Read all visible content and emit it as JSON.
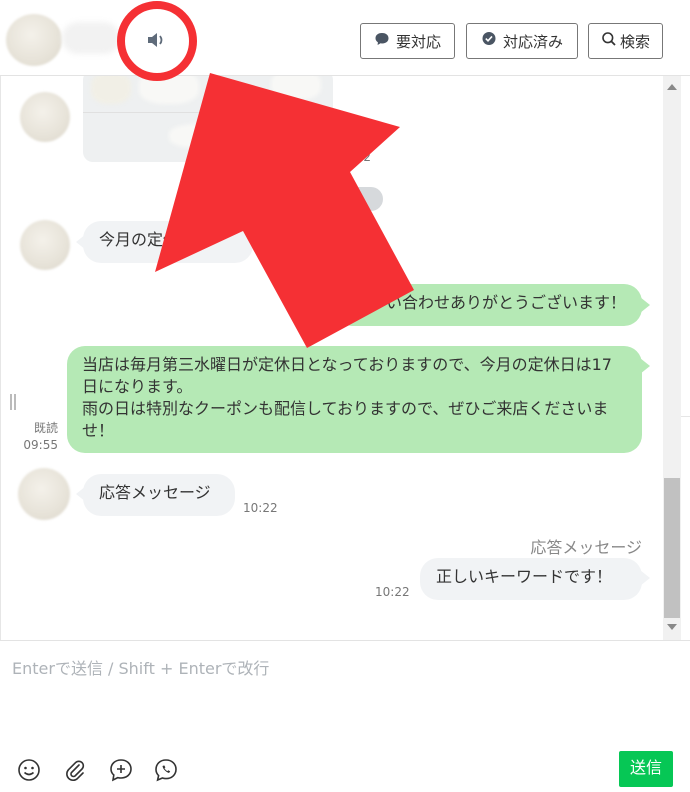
{
  "header": {
    "speaker_icon": "speaker-icon",
    "buttons": [
      {
        "label": "要対応",
        "icon": "speech-bubble-icon"
      },
      {
        "label": "対応済み",
        "icon": "check-bubble-icon"
      },
      {
        "label": "検索",
        "icon": "search-icon"
      }
    ]
  },
  "messages": {
    "image_time": "6:22",
    "date_pill": "日",
    "incoming_1": "今月の定休日は",
    "outgoing_1": "い合わせありがとうございます！",
    "outgoing_2": "当店は毎月第三水曜日が定休日となっておりますので、今月の定休日は17日になります。\n雨の日は特別なクーポンも配信しておりますので、ぜひご来店くださいませ！",
    "read_label": "既読",
    "read_time": "09:55",
    "incoming_2": "応答メッセージ",
    "incoming_2_time": "10:22",
    "response_label": "応答メッセージ",
    "outgoing_3": "正しいキーワードです！",
    "outgoing_3_time": "10:22"
  },
  "composer": {
    "placeholder": "Enterで送信 / Shift + Enterで改行",
    "tools": [
      "smile-icon",
      "paperclip-icon",
      "plus-bubble-icon",
      "phone-bubble-icon"
    ],
    "send_label": "送信"
  },
  "colors": {
    "outgoing_bubble": "#b5e9b5",
    "incoming_bubble": "#f1f3f5",
    "send_button": "#06c755",
    "annotation_red": "#f53034"
  }
}
